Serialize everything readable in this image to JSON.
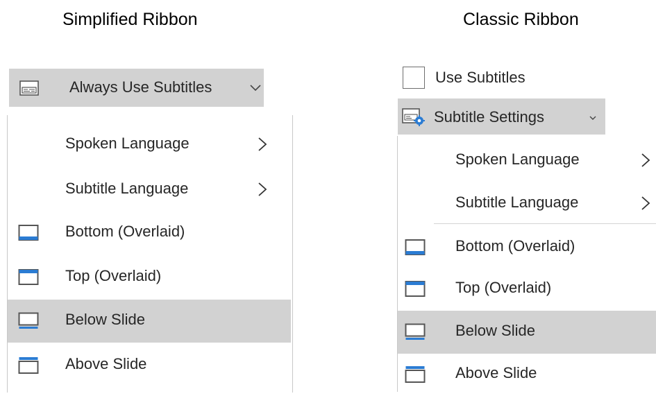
{
  "headings": {
    "simplified": "Simplified Ribbon",
    "classic": "Classic Ribbon"
  },
  "simplified": {
    "button_label": "Always Use Subtitles",
    "button_icon": "subtitles-icon",
    "menu": [
      {
        "label": "Spoken Language",
        "submenu": true
      },
      {
        "label": "Subtitle Language",
        "submenu": true
      },
      {
        "label": "Bottom (Overlaid)",
        "icon": "bottom-overlaid-icon"
      },
      {
        "label": "Top (Overlaid)",
        "icon": "top-overlaid-icon"
      },
      {
        "label": "Below Slide",
        "icon": "below-slide-icon",
        "highlighted": true
      },
      {
        "label": "Above Slide",
        "icon": "above-slide-icon"
      }
    ]
  },
  "classic": {
    "checkbox_label": "Use Subtitles",
    "checkbox_checked": false,
    "settings_label": "Subtitle Settings",
    "settings_icon": "subtitle-settings-icon",
    "menu": [
      {
        "label": "Spoken Language",
        "submenu": true
      },
      {
        "label": "Subtitle Language",
        "submenu": true
      },
      {
        "label": "Bottom (Overlaid)",
        "icon": "bottom-overlaid-icon"
      },
      {
        "label": "Top (Overlaid)",
        "icon": "top-overlaid-icon"
      },
      {
        "label": "Below Slide",
        "icon": "below-slide-icon",
        "highlighted": true
      },
      {
        "label": "Above Slide",
        "icon": "above-slide-icon"
      }
    ]
  },
  "colors": {
    "highlight": "#d2d2d2",
    "accent_blue": "#2b7cd3",
    "icon_gray": "#555555"
  }
}
